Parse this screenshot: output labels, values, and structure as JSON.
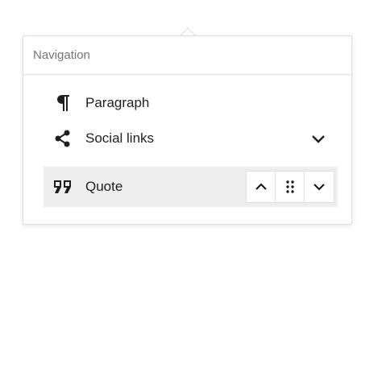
{
  "navigation": {
    "title": "Navigation"
  },
  "blocks": [
    {
      "label": "Paragraph",
      "icon": "paragraph-icon"
    },
    {
      "label": "Social links",
      "icon": "share-icon"
    },
    {
      "label": "Quote",
      "icon": "quote-icon"
    }
  ],
  "colors": {
    "selected_bg": "#eeeeee",
    "border": "#e0e0e0",
    "text": "#1e1e1e",
    "muted": "#757575"
  }
}
